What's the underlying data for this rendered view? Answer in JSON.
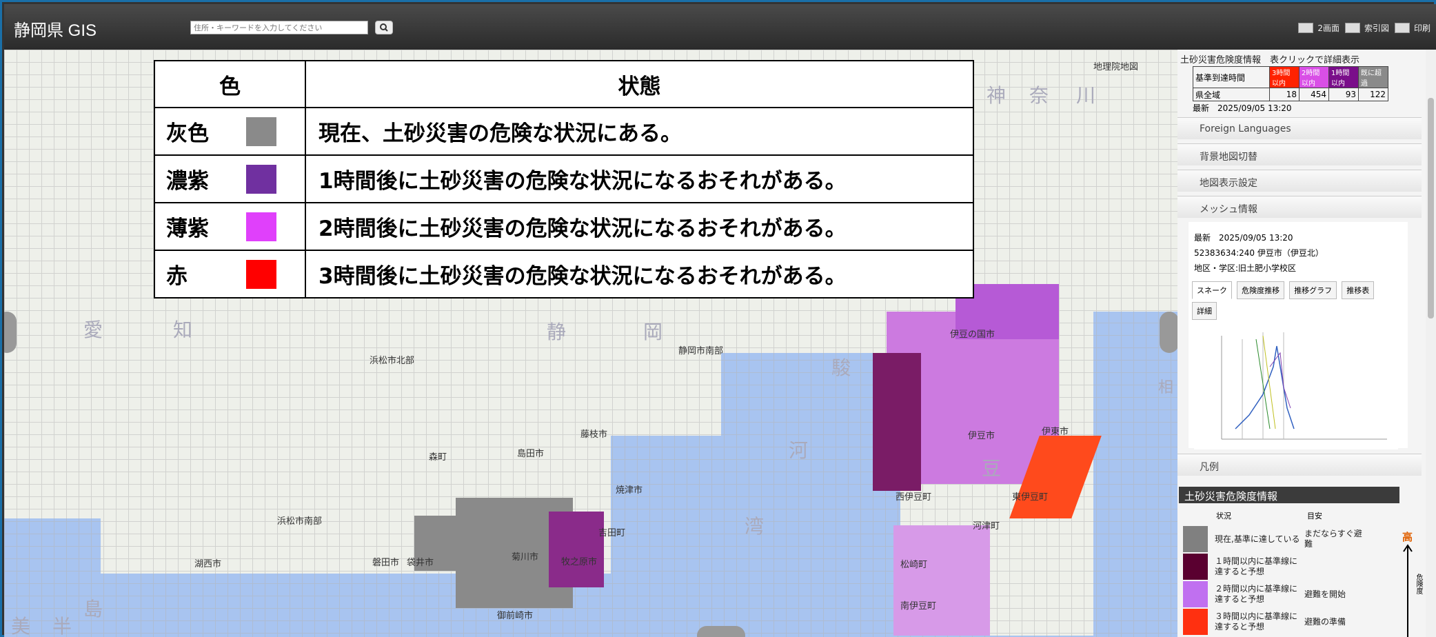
{
  "header": {
    "title": "静岡県 GIS",
    "search_placeholder": "住所・キーワードを入力してください",
    "tools": [
      "2画面",
      "索引図",
      "印刷"
    ]
  },
  "legend_overlay": {
    "col_color": "色",
    "col_status": "状態",
    "rows": [
      {
        "name": "灰色",
        "color": "#8a8a8a",
        "status": "現在、土砂災害の危険な状況にある。"
      },
      {
        "name": "濃紫",
        "color": "#7030a0",
        "status": "1時間後に土砂災害の危険な状況になるおそれがある。"
      },
      {
        "name": "薄紫",
        "color": "#e040fb",
        "status": "2時間後に土砂災害の危険な状況になるおそれがある。"
      },
      {
        "name": "赤",
        "color": "#ff0000",
        "status": "3時間後に土砂災害の危険な状況になるおそれがある。"
      }
    ]
  },
  "map_labels": {
    "big": [
      "神",
      "奈",
      "川",
      "愛",
      "知",
      "静",
      "岡",
      "駿",
      "河",
      "湾",
      "豆",
      "美",
      "半",
      "島",
      "相"
    ],
    "places": [
      "地理院地図",
      "浜松市北部",
      "静岡市南部",
      "藤枝市",
      "森町",
      "島田市",
      "浜松市南部",
      "湖西市",
      "磐田市",
      "袋井市",
      "菊川市",
      "牧之原市",
      "御前崎市",
      "伊豆の国市",
      "伊豆市",
      "伊東市",
      "西伊豆町",
      "東伊豆町",
      "松崎町",
      "河津町",
      "南伊豆町",
      "焼津市",
      "吉田町"
    ]
  },
  "panel": {
    "title": "土砂災害危険度情報　表クリックで詳細表示",
    "summary_header": [
      "基準到達時間",
      "3時間以内",
      "2時間以内",
      "1時間以内",
      "既に超過"
    ],
    "summary_row": [
      "県全域",
      "18",
      "454",
      "93",
      "122"
    ],
    "latest": "最新　2025/09/05 13:20",
    "accordion": [
      "Foreign Languages",
      "背景地図切替",
      "地図表示設定",
      "メッシュ情報"
    ],
    "mesh": {
      "latest": "最新　2025/09/05 13:20",
      "code": "52383634:240 伊豆市（伊豆北）",
      "district": "地区・学区:旧土肥小学校区",
      "tabs": [
        "スネーク",
        "危険度推移",
        "推移グラフ",
        "推移表",
        "詳細"
      ]
    },
    "legend_section": "凡例",
    "legend_head": "土砂災害危険度情報",
    "legend_cols": [
      "状況",
      "目安"
    ],
    "legend_rows": [
      {
        "color": "#808080",
        "text": "現在,基準に達している",
        "guide": "まだならすぐ避難"
      },
      {
        "color": "#5a0030",
        "text": "１時間以内に基準線に達すると予想",
        "guide": ""
      },
      {
        "color": "#c070f0",
        "text": "２時間以内に基準線に達すると予想",
        "guide": "避難を開始"
      },
      {
        "color": "#ff3010",
        "text": "３時間以内に基準線に達すると予想",
        "guide": "避難の準備"
      }
    ],
    "high_label": "高",
    "risk_label": "危険度"
  }
}
